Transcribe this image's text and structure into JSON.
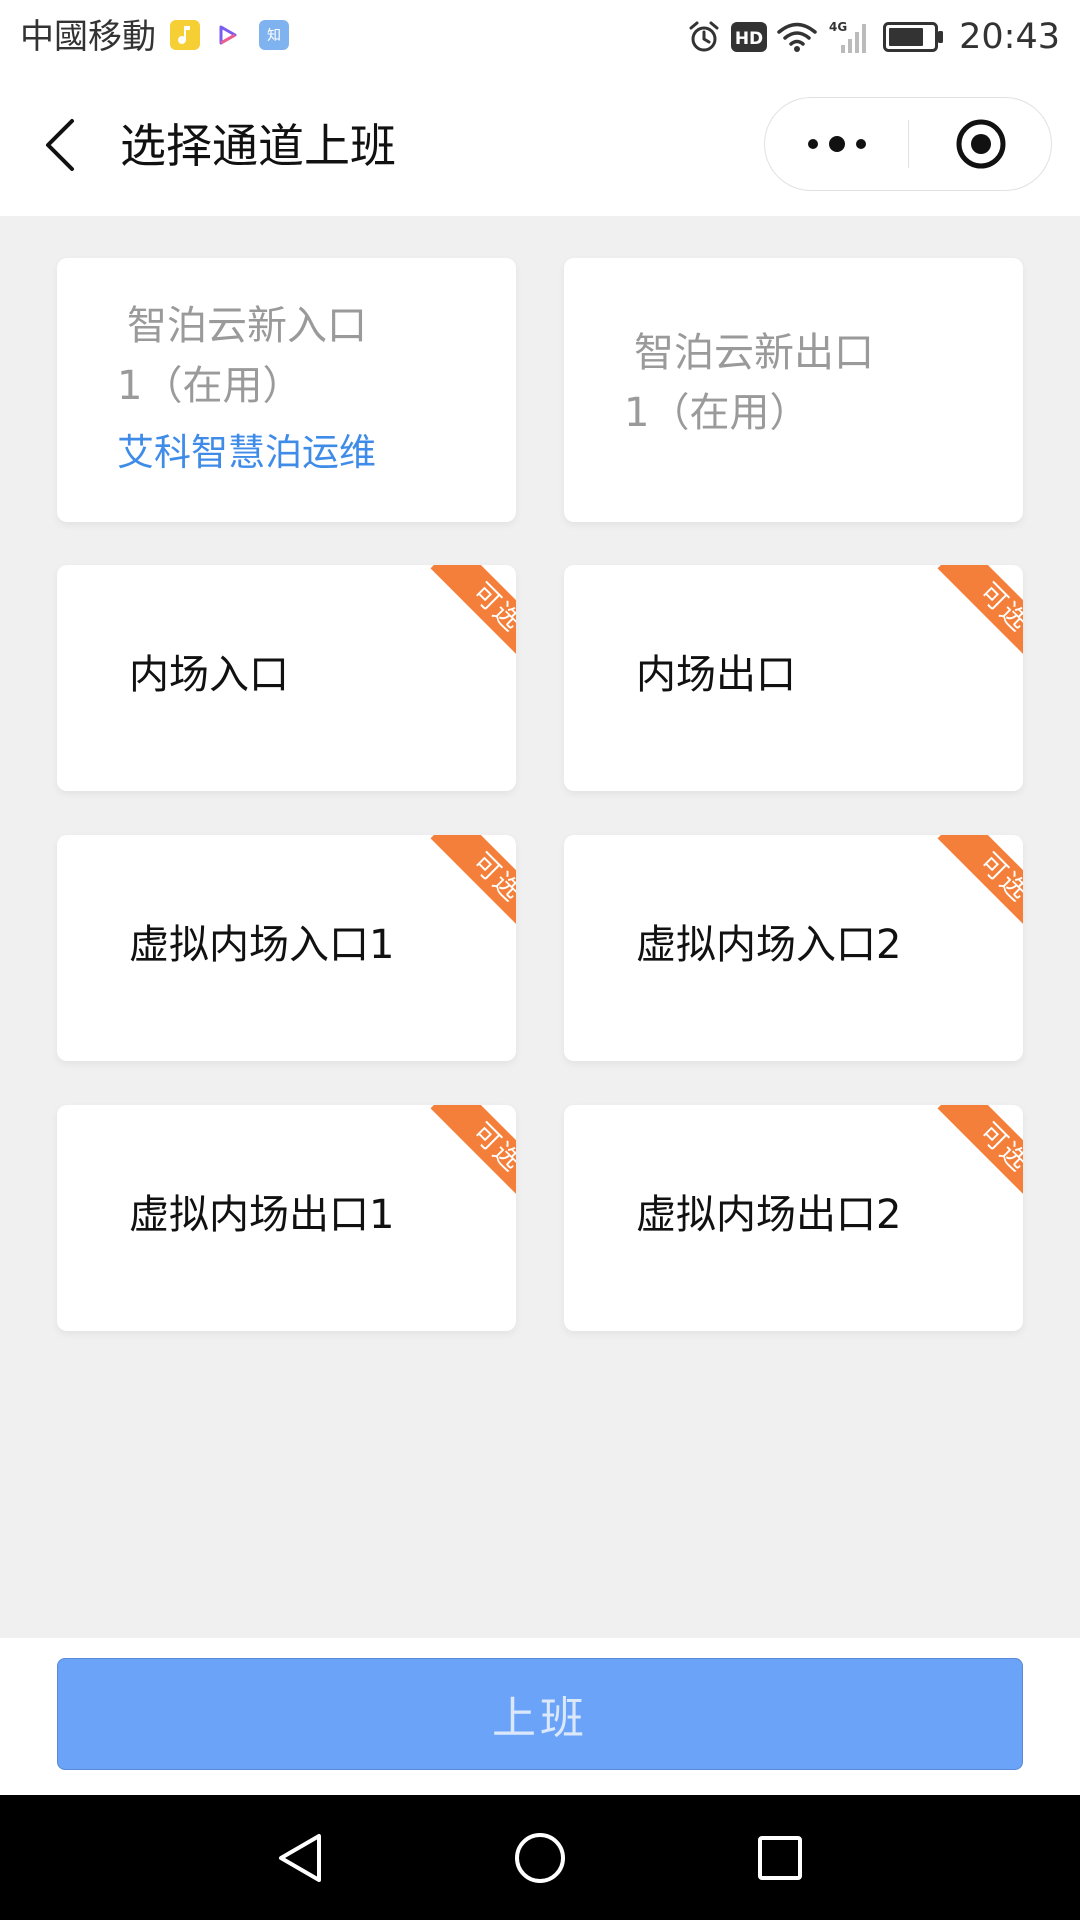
{
  "status_bar": {
    "carrier": "中國移動",
    "app_icons": [
      "music-app-icon",
      "video-app-icon",
      "zhihu-app-icon"
    ],
    "app_icon_text": {
      "zhihu": "知"
    },
    "indicators": [
      "alarm-icon",
      "hd-icon",
      "wifi-icon",
      "4g-signal-icon",
      "battery-icon"
    ],
    "hd_label": "HD",
    "network_label": "4G",
    "time": "20:43"
  },
  "header": {
    "title": "选择通道上班",
    "back_icon": "back-arrow-icon",
    "more_icon": "more-dots-icon",
    "close_icon": "miniprogram-close-icon"
  },
  "channels": [
    {
      "name_line1": "智泊云新入口",
      "name_line2": "1（在用）",
      "user": "艾科智慧泊运维",
      "in_use": true
    },
    {
      "name_line1": "智泊云新出口",
      "name_line2": "1（在用）",
      "in_use": true
    },
    {
      "name": "内场入口",
      "badge": "可选",
      "in_use": false
    },
    {
      "name": "内场出口",
      "badge": "可选",
      "in_use": false
    },
    {
      "name": "虚拟内场入口1",
      "badge": "可选",
      "in_use": false
    },
    {
      "name": "虚拟内场入口2",
      "badge": "可选",
      "in_use": false
    },
    {
      "name": "虚拟内场出口1",
      "badge": "可选",
      "in_use": false
    },
    {
      "name": "虚拟内场出口2",
      "badge": "可选",
      "in_use": false
    }
  ],
  "footer": {
    "clock_in_label": "上班"
  },
  "system_nav": {
    "back_icon": "nav-back-triangle-icon",
    "home_icon": "nav-home-circle-icon",
    "recents_icon": "nav-recents-square-icon"
  },
  "colors": {
    "badge": "#f47f3a",
    "user_link": "#3f8ce8",
    "button_disabled": "#6aa3f8",
    "background": "#f0f0f0"
  }
}
